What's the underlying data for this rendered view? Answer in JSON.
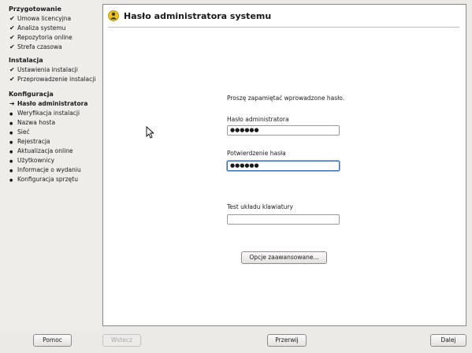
{
  "sidebar": {
    "sections": [
      {
        "title": "Przygotowanie",
        "items": [
          {
            "label": "Umowa licencyjna",
            "state": "done"
          },
          {
            "label": "Analiza systemu",
            "state": "done"
          },
          {
            "label": "Repozytoria online",
            "state": "done"
          },
          {
            "label": "Strefa czasowa",
            "state": "done"
          }
        ]
      },
      {
        "title": "Instalacja",
        "items": [
          {
            "label": "Ustawienia instalacji",
            "state": "done"
          },
          {
            "label": "Przeprowadzenie instalacji",
            "state": "done"
          }
        ]
      },
      {
        "title": "Konfiguracja",
        "items": [
          {
            "label": "Hasło administratora",
            "state": "current"
          },
          {
            "label": "Weryfikacja instalacji",
            "state": "pending"
          },
          {
            "label": "Nazwa hosta",
            "state": "pending"
          },
          {
            "label": "Sieć",
            "state": "pending"
          },
          {
            "label": "Rejestracja",
            "state": "pending"
          },
          {
            "label": "Aktualizacja online",
            "state": "pending"
          },
          {
            "label": "Użytkownicy",
            "state": "pending"
          },
          {
            "label": "Informacje o wydaniu",
            "state": "pending"
          },
          {
            "label": "Konfiguracja sprzętu",
            "state": "pending"
          }
        ]
      }
    ],
    "marks": {
      "done": "✔",
      "current": "➔",
      "pending": "●"
    }
  },
  "main": {
    "title": "Hasło administratora systemu",
    "icon": "user-icon",
    "note": "Proszę zapamiętać wprowadzone hasło.",
    "password_label": "Hasło administratora",
    "password_value": "●●●●●●",
    "confirm_label": "Potwierdzenie hasła",
    "confirm_value": "●●●●●●",
    "keyboard_test_label": "Test układu klawiatury",
    "keyboard_test_value": "",
    "advanced_button": "Opcje zaawansowane..."
  },
  "footer": {
    "help": "Pomoc",
    "back": "Wstecz",
    "abort": "Przerwij",
    "next": "Dalej"
  },
  "colors": {
    "focus_border": "#3d6fb3",
    "window_bg": "#eceae6"
  }
}
